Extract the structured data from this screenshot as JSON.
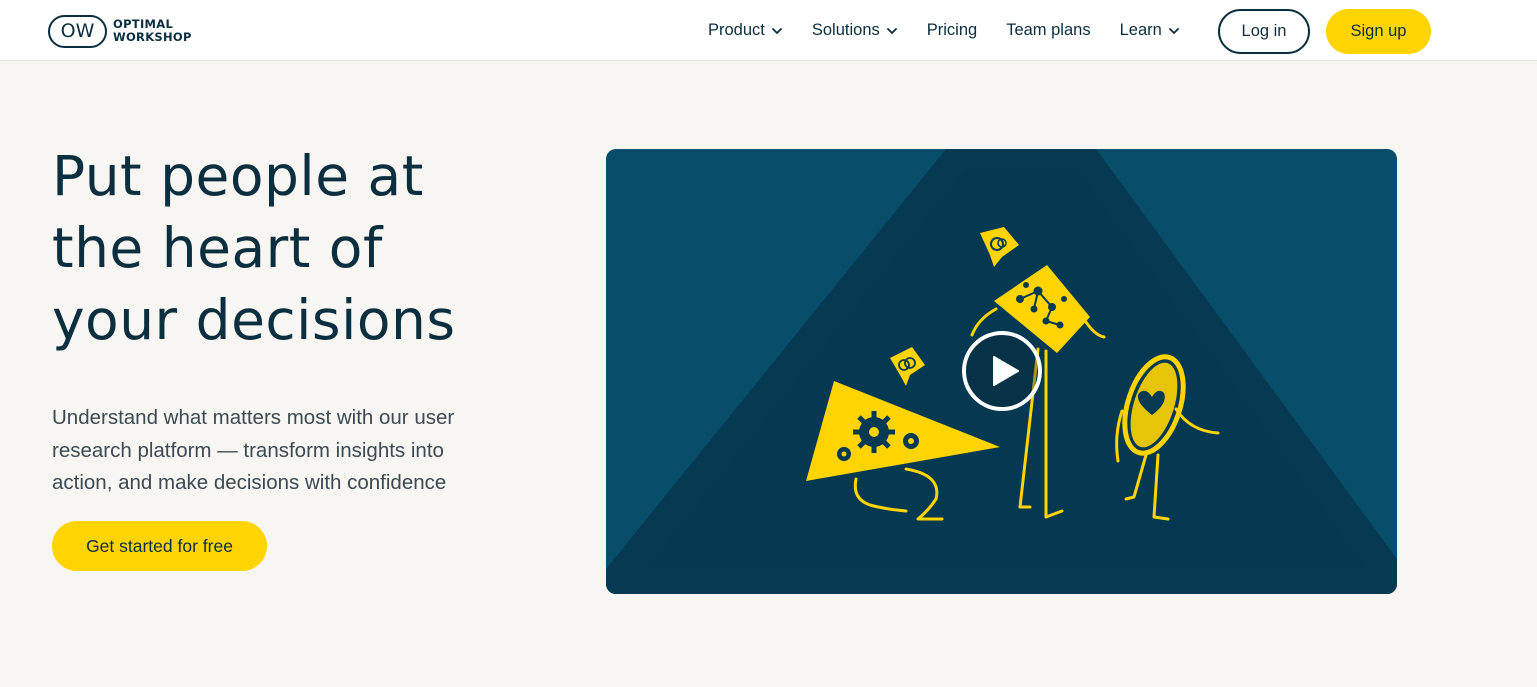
{
  "header": {
    "logo_mark": "OW",
    "logo_line1": "OPTIMAL",
    "logo_line2": "WORKSHOP",
    "nav": [
      {
        "label": "Product",
        "has_dropdown": true
      },
      {
        "label": "Solutions",
        "has_dropdown": true
      },
      {
        "label": "Pricing",
        "has_dropdown": false
      },
      {
        "label": "Team plans",
        "has_dropdown": false
      },
      {
        "label": "Learn",
        "has_dropdown": true
      }
    ],
    "login_label": "Log in",
    "signup_label": "Sign up"
  },
  "hero": {
    "title_line1": "Put people at",
    "title_line2": "the heart of",
    "title_line3": "your decisions",
    "subtitle_line1": "Understand what matters most with our user",
    "subtitle_line2": "research platform — transform insights into",
    "subtitle_line3": "action, and make decisions with confidence",
    "cta_label": "Get started for free"
  },
  "video": {
    "play_icon": "play-icon"
  },
  "colors": {
    "accent": "#ffd400",
    "navy": "#0b2f3f",
    "video_bg": "#084d69",
    "page_bg": "#f8f6f3"
  }
}
